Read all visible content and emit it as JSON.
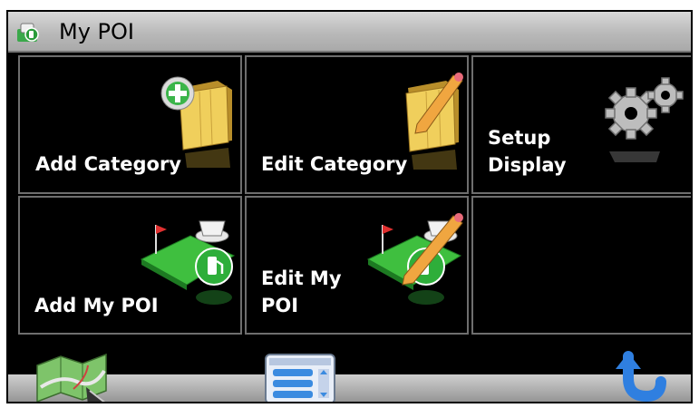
{
  "titlebar": {
    "title": "My POI",
    "icon": "my-poi-app-icon"
  },
  "tiles": [
    {
      "label": "Add Category",
      "icon": "folder-add-icon"
    },
    {
      "label": "Edit Category",
      "icon": "folder-edit-icon"
    },
    {
      "label_line1": "Setup",
      "label_line2": "Display",
      "icon": "gear-icon"
    },
    {
      "label": "Add My POI",
      "icon": "poi-add-icon"
    },
    {
      "label_line1": "Edit My",
      "label_line2": "POI",
      "icon": "poi-edit-icon"
    },
    {
      "label": "",
      "icon": ""
    }
  ],
  "bottombar": {
    "buttons": [
      {
        "icon": "map-icon"
      },
      {
        "icon": "menu-list-icon"
      },
      {
        "icon": "back-arrow-icon"
      }
    ]
  },
  "colors": {
    "accent_blue": "#2f7fe0",
    "tile_border": "#6e6e6e",
    "folder_yellow": "#e8c24a",
    "poi_green": "#2eae3a"
  }
}
